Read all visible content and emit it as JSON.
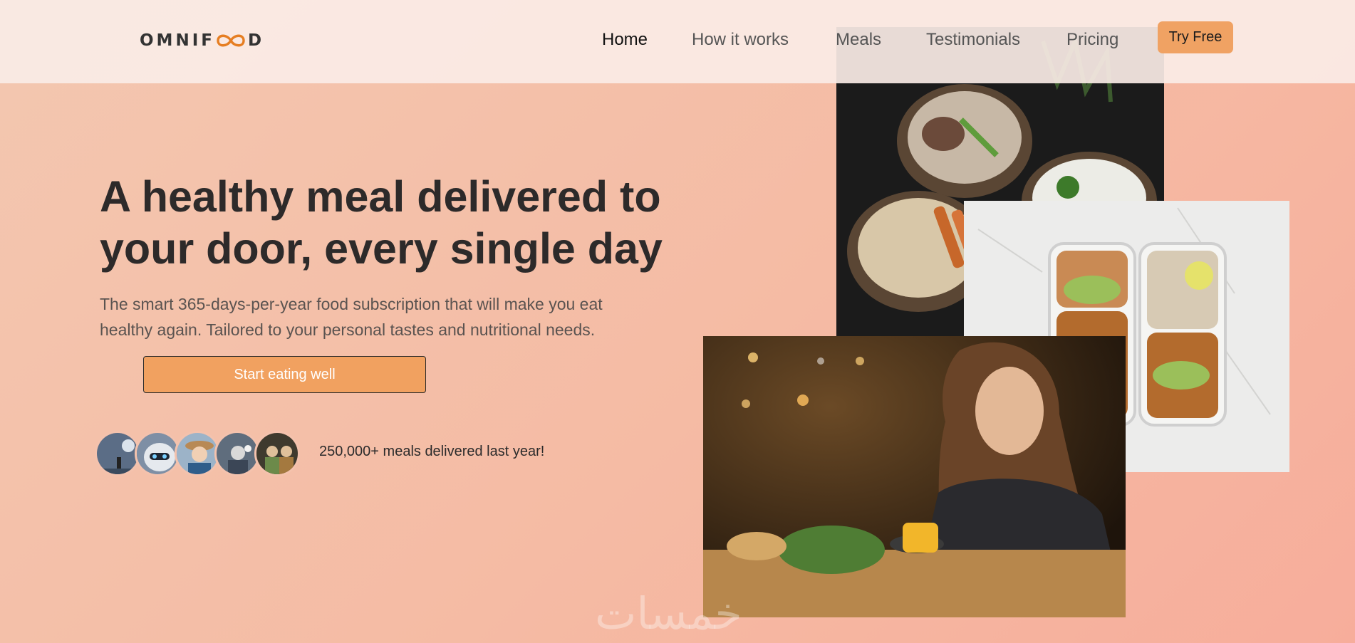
{
  "brand": {
    "name_prefix": "OMNIF",
    "name_suffix": "D",
    "accent": "#e67e22"
  },
  "nav": {
    "items": [
      {
        "label": "Home",
        "active": true
      },
      {
        "label": "How it works",
        "active": false
      },
      {
        "label": "Meals",
        "active": false
      },
      {
        "label": "Testimonials",
        "active": false
      },
      {
        "label": "Pricing",
        "active": false
      }
    ],
    "cta_label": "Try Free"
  },
  "hero": {
    "title_line1": "A healthy meal delivered to",
    "title_line2": "your door, every single day",
    "subtitle_line1": "The smart 365-days-per-year food subscription that will make you eat",
    "subtitle_line2": "healthy again. Tailored to your personal tastes and nutritional needs.",
    "cta_label": "Start eating well",
    "social_proof": "250,000+ meals delivered last year!"
  },
  "images": [
    {
      "name": "bowls-photo",
      "icon": "food-bowls-image"
    },
    {
      "name": "meal-prep-photo",
      "icon": "meal-prep-containers-image"
    },
    {
      "name": "woman-eating-photo",
      "icon": "woman-eating-image"
    }
  ],
  "watermark": "خمسات",
  "colors": {
    "primary": "#f1a160",
    "text_dark": "#2d2a2a",
    "nav_bg": "#faece6"
  }
}
